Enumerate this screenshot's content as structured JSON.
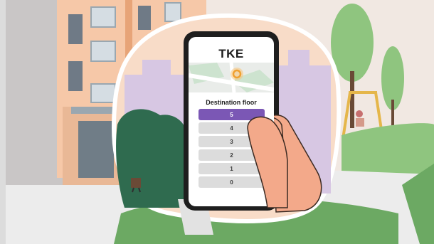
{
  "app": {
    "brand_logo_text": "TKE",
    "screen_title": "Destination floor",
    "selected_floor": "5"
  },
  "floors": [
    {
      "label": "5",
      "selected": true
    },
    {
      "label": "4",
      "selected": false
    },
    {
      "label": "3",
      "selected": false
    },
    {
      "label": "2",
      "selected": false
    },
    {
      "label": "1",
      "selected": false
    },
    {
      "label": "0",
      "selected": false
    }
  ],
  "colors": {
    "accent_purple": "#7b57b5",
    "map_pin_orange": "#f0a030",
    "tree_green": "#2f6b4f",
    "skin": "#f3a98a"
  }
}
